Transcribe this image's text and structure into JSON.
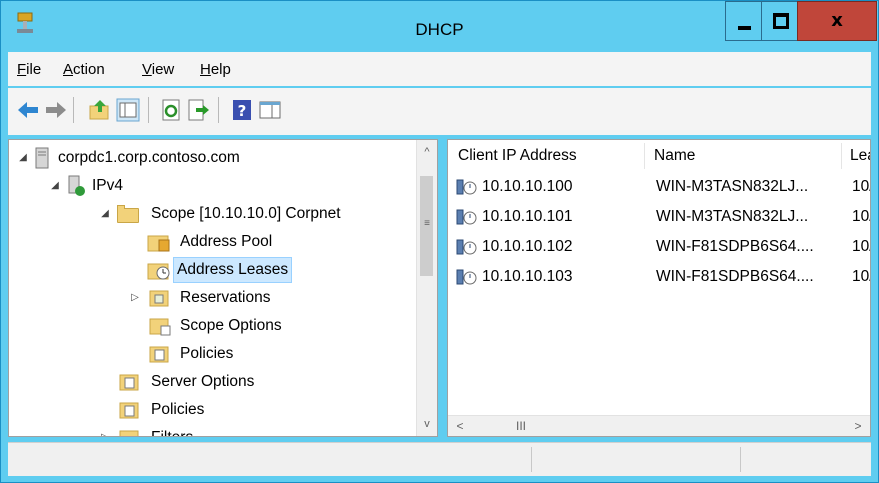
{
  "window": {
    "title": "DHCP",
    "close_glyph": "x",
    "colors": {
      "frame": "#5fcdf0",
      "close": "#c0463a",
      "selection": "#cce8ff"
    }
  },
  "menu": {
    "items": [
      {
        "label": "File",
        "accel": "F",
        "rest": "ile"
      },
      {
        "label": "Action",
        "accel": "A",
        "rest": "ction"
      },
      {
        "label": "View",
        "accel": "V",
        "rest": "iew"
      },
      {
        "label": "Help",
        "accel": "H",
        "rest": "elp"
      }
    ]
  },
  "toolbar": {
    "icons": [
      "back-arrow-icon",
      "forward-arrow-icon",
      "up-folder-icon",
      "show-hide-tree-icon",
      "refresh-icon",
      "export-list-icon",
      "help-icon",
      "properties-icon"
    ]
  },
  "tree": {
    "items": [
      {
        "label": "corpdc1.corp.contoso.com",
        "icon": "server-icon",
        "expander": "open"
      },
      {
        "label": "IPv4",
        "icon": "ipv4-icon",
        "expander": "open"
      },
      {
        "label": "Scope [10.10.10.0] Corpnet",
        "icon": "folder-icon",
        "expander": "open"
      },
      {
        "label": "Address Pool",
        "icon": "address-pool-icon",
        "expander": ""
      },
      {
        "label": "Address Leases",
        "icon": "address-leases-icon",
        "expander": ""
      },
      {
        "label": "Reservations",
        "icon": "reservations-icon",
        "expander": "closed"
      },
      {
        "label": "Scope Options",
        "icon": "scope-options-icon",
        "expander": ""
      },
      {
        "label": "Policies",
        "icon": "policies-icon",
        "expander": ""
      },
      {
        "label": "Server Options",
        "icon": "server-options-icon",
        "expander": ""
      },
      {
        "label": "Policies",
        "icon": "policies-icon",
        "expander": ""
      },
      {
        "label": "Filters",
        "icon": "filters-icon",
        "expander": "closed"
      }
    ],
    "selected": "Address Leases"
  },
  "leases": {
    "columns": [
      "Client IP Address",
      "Name",
      "Lea"
    ],
    "rows": [
      {
        "ip": "10.10.10.100",
        "name": "WIN-M3TASN832LJ...",
        "lease": "10/"
      },
      {
        "ip": "10.10.10.101",
        "name": "WIN-M3TASN832LJ...",
        "lease": "10/"
      },
      {
        "ip": "10.10.10.102",
        "name": "WIN-F81SDPB6S64....",
        "lease": "10/"
      },
      {
        "ip": "10.10.10.103",
        "name": "WIN-F81SDPB6S64....",
        "lease": "10/"
      }
    ]
  },
  "scrollbars": {
    "vertical_up": "^",
    "vertical_down": "v",
    "vertical_grip": "≡",
    "horizontal_left": "<",
    "horizontal_right": ">",
    "horizontal_grip": "III"
  }
}
